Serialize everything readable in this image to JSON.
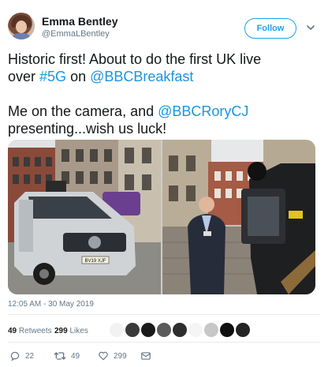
{
  "user": {
    "name": "Emma Bentley",
    "handle": "@EmmaLBentley"
  },
  "follow_label": "Follow",
  "tweet": {
    "line1_prefix": "Historic first! About to do the first UK live",
    "line2_prefix": "over ",
    "hashtag": "#5G",
    "line2_mid": " on ",
    "mention1": "@BBCBreakfast",
    "line3_prefix": "Me on the camera, and ",
    "mention2": "@BBCRoryCJ",
    "line4": "presenting...wish us luck!"
  },
  "photo_plate": "BV19 XJF",
  "timestamp": "12:05 AM - 30 May 2019",
  "stats": {
    "retweets_count": "49",
    "retweets_label": "Retweets",
    "likes_count": "299",
    "likes_label": "Likes"
  },
  "actions": {
    "replies": "22",
    "retweets": "49",
    "likes": "299"
  },
  "colors": {
    "accent": "#1da1f2",
    "link": "#1b95e0",
    "muted": "#657786"
  }
}
